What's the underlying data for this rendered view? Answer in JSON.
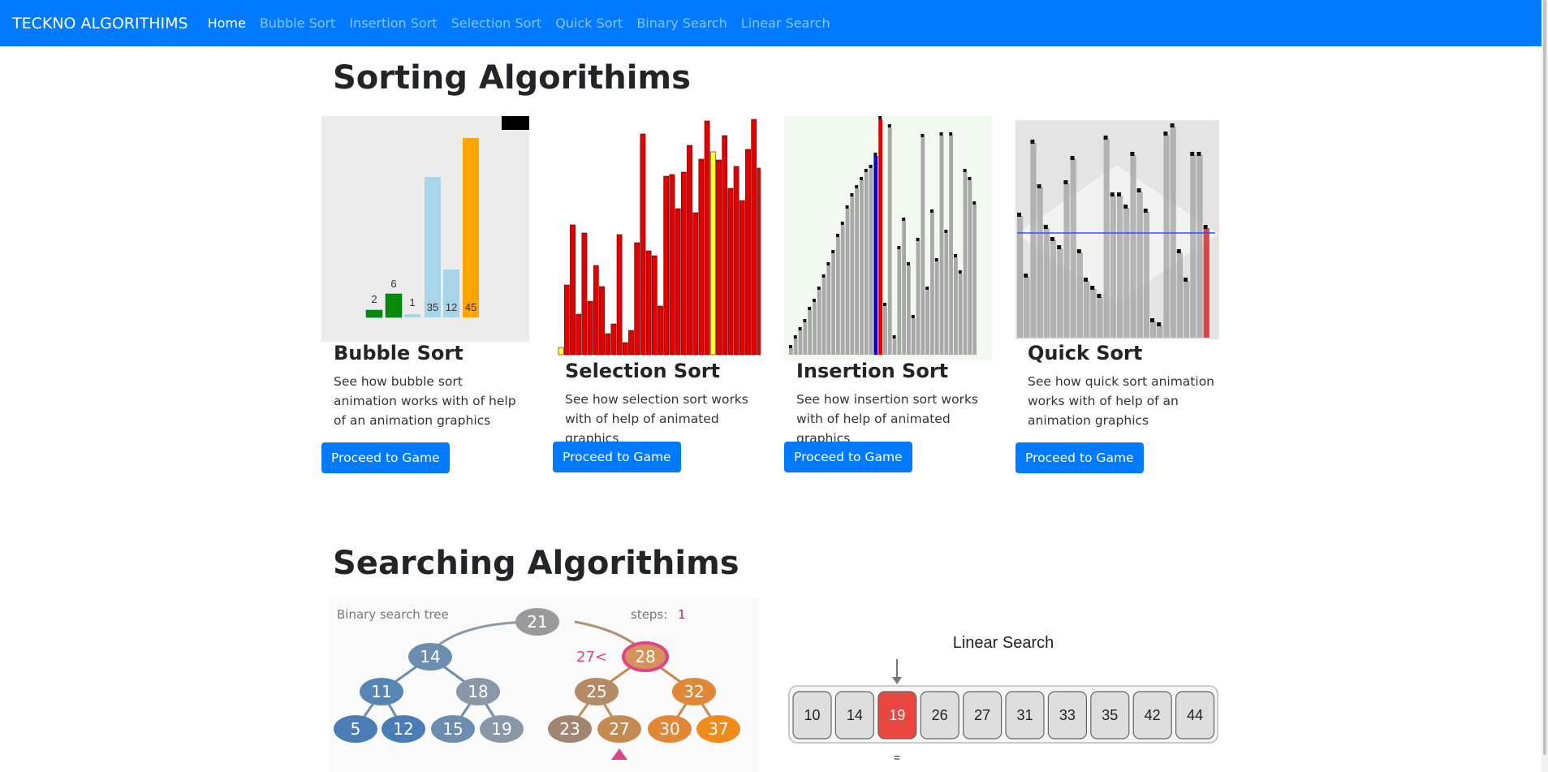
{
  "navbar": {
    "brand": "TECKNO ALGORITHIMS",
    "links": [
      "Home",
      "Bubble Sort",
      "Insertion Sort",
      "Selection Sort",
      "Quick Sort",
      "Binary Search",
      "Linear Search"
    ]
  },
  "sorting": {
    "heading": "Sorting Algorithims",
    "cards": [
      {
        "title": "Bubble Sort",
        "description": "See how bubble sort animation works with of help of an animation graphics",
        "button": "Proceed to Game"
      },
      {
        "title": "Selection Sort",
        "description": "See how selection sort works with of help of animated graphics",
        "button": "Proceed to Game"
      },
      {
        "title": "Insertion Sort",
        "description": "See how insertion sort works with of help of animated graphics",
        "button": "Proceed to Game"
      },
      {
        "title": "Quick Sort",
        "description": "See how quick sort animation works with of help of an animation graphics",
        "button": "Proceed to Game"
      }
    ],
    "bubble_image": {
      "bar_labels": [
        "2",
        "6",
        "1",
        "35",
        "12",
        "45"
      ]
    }
  },
  "searching": {
    "heading": "Searching Algorithims",
    "binary_image": {
      "caption": "Binary search tree",
      "steps_label": "steps:",
      "steps_value": "1",
      "comparison": "27<",
      "nodes": [
        "21",
        "14",
        "28",
        "11",
        "18",
        "25",
        "32",
        "5",
        "12",
        "15",
        "19",
        "23",
        "27",
        "30",
        "37"
      ]
    },
    "linear_image": {
      "title": "Linear Search",
      "values": [
        "10",
        "14",
        "19",
        "26",
        "27",
        "31",
        "33",
        "35",
        "42",
        "44"
      ],
      "equals": "="
    }
  },
  "colors": {
    "primary": "#007bff",
    "bar_red": "#e10000",
    "bar_gray": "#a9a9a9",
    "highlight_red": "#e8463f"
  }
}
